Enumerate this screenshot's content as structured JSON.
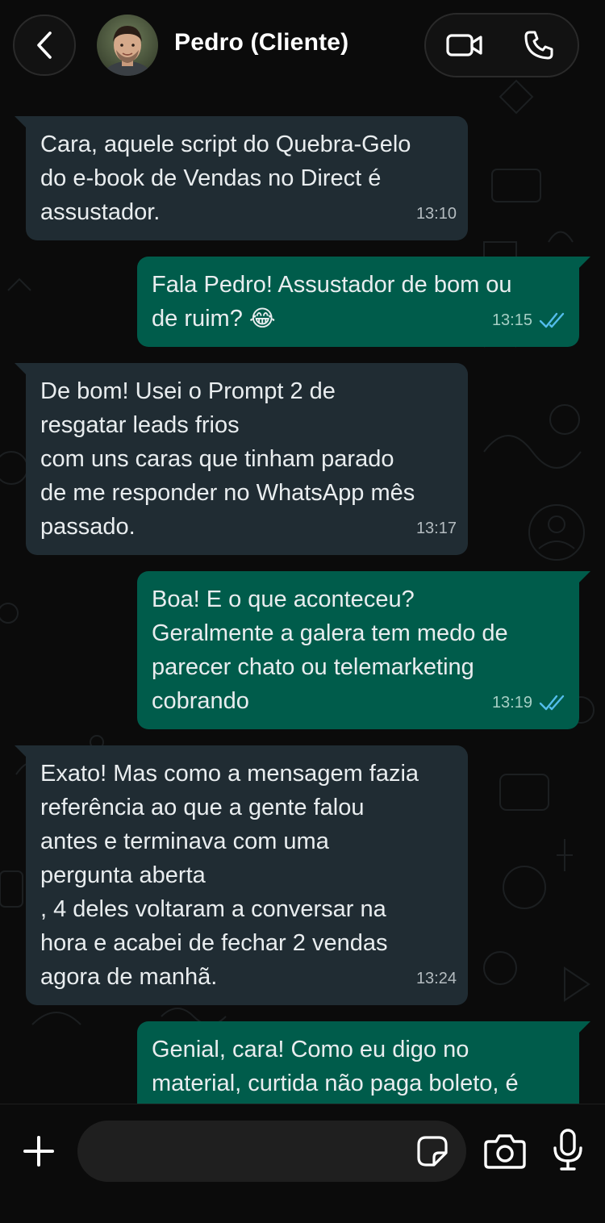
{
  "header": {
    "contact_name": "Pedro (Cliente)",
    "back_icon": "chevron-left-icon",
    "video_icon": "video-camera-icon",
    "phone_icon": "phone-icon"
  },
  "messages": [
    {
      "direction": "incoming",
      "text": "Cara, aquele script do Quebra-Gelo\ndo e-book de Vendas no Direct é\nassustador.",
      "time": "13:10"
    },
    {
      "direction": "outgoing",
      "text": "Fala Pedro! Assustador de bom ou\nde ruim?",
      "emoji": "😂",
      "time": "13:15",
      "status": "read"
    },
    {
      "direction": "incoming",
      "text": "De bom! Usei o Prompt 2 de\nresgatar leads frios\ncom uns caras que tinham parado\nde me responder no WhatsApp mês\npassado.",
      "time": "13:17"
    },
    {
      "direction": "outgoing",
      "text": "Boa! E o que aconteceu?\nGeralmente a galera tem medo de\nparecer chato ou telemarketing\ncobrando",
      "time": "13:19",
      "status": "read"
    },
    {
      "direction": "incoming",
      "text": "Exato! Mas como a mensagem fazia\nreferência ao que a gente falou\nantes e terminava com uma\npergunta aberta\n, 4 deles voltaram a conversar na\nhora e acabei de fechar 2 vendas\nagora de manhã.",
      "time": "13:24"
    },
    {
      "direction": "outgoing",
      "text": "Genial, cara! Como eu digo no\nmaterial, curtida não paga boleto, é",
      "time": "",
      "status": ""
    }
  ],
  "composer": {
    "placeholder": "",
    "value": "",
    "plus_icon": "plus-icon",
    "sticker_icon": "sticker-icon",
    "camera_icon": "camera-icon",
    "mic_icon": "microphone-icon"
  },
  "colors": {
    "background": "#0b0b0b",
    "incoming_bubble": "#202c33",
    "outgoing_bubble": "#005c4b",
    "read_ticks": "#53bdeb",
    "text": "#e9edef"
  }
}
